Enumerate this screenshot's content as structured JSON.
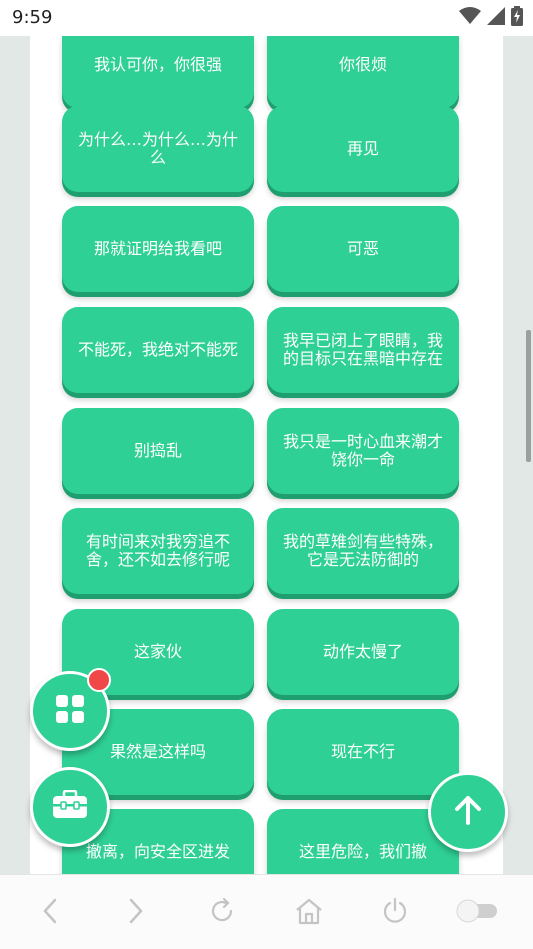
{
  "status_bar": {
    "time": "9:59",
    "icons": [
      "wifi-icon",
      "signal-icon",
      "battery-charging-icon"
    ]
  },
  "buttons": [
    {
      "text": "我认可你，你很强"
    },
    {
      "text": "你很烦"
    },
    {
      "text": "为什么…为什么…为什么"
    },
    {
      "text": "再见"
    },
    {
      "text": "那就证明给我看吧"
    },
    {
      "text": "可恶"
    },
    {
      "text": "不能死，我绝对不能死"
    },
    {
      "text": "我早已闭上了眼睛，我的目标只在黑暗中存在"
    },
    {
      "text": "别捣乱"
    },
    {
      "text": "我只是一时心血来潮才饶你一命"
    },
    {
      "text": "有时间来对我穷追不舍，还不如去修行呢"
    },
    {
      "text": "我的草雉剑有些特殊，它是无法防御的"
    },
    {
      "text": "这家伙"
    },
    {
      "text": "动作太慢了"
    },
    {
      "text": "果然是这样吗"
    },
    {
      "text": "现在不行"
    },
    {
      "text": "撤离，向安全区进发"
    },
    {
      "text": "这里危险，我们撤"
    }
  ],
  "floating": {
    "grid_icon": "grid-icon",
    "toolbox_icon": "toolbox-icon",
    "up_icon": "arrow-up-icon"
  },
  "nav_bar": {
    "icons": [
      "back-icon",
      "forward-icon",
      "refresh-icon",
      "home-icon",
      "power-icon",
      "toggle-icon"
    ]
  },
  "colors": {
    "button_green": "#2fd096",
    "button_shadow": "#1f9e6f",
    "badge_red": "#f04848",
    "background": "#e2e8e5"
  }
}
